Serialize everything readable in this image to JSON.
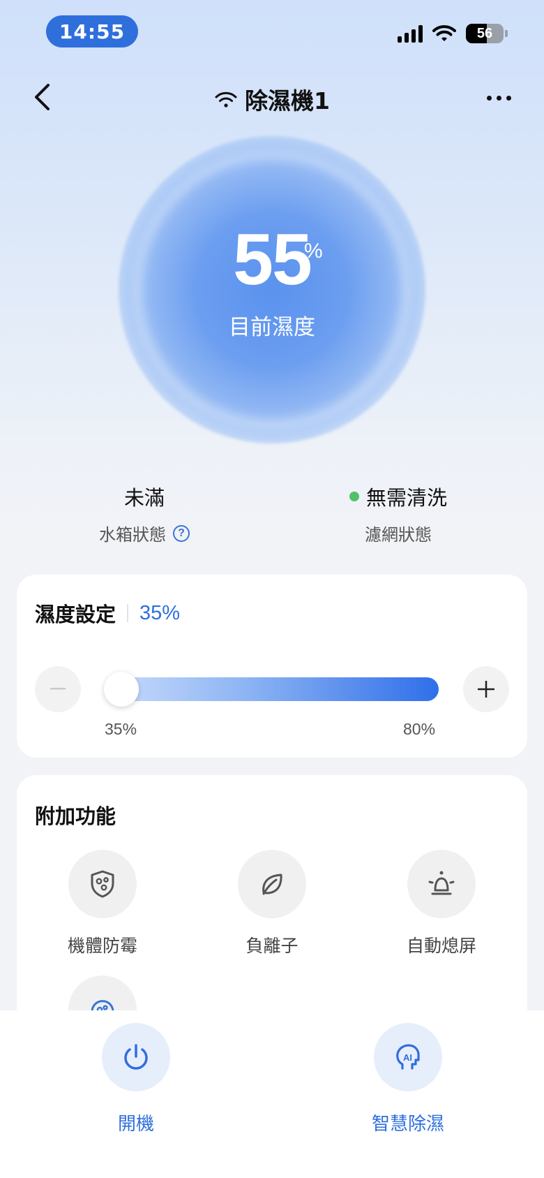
{
  "status_bar": {
    "time": "14:55",
    "battery": "56"
  },
  "header": {
    "title": "除濕機1"
  },
  "humidity": {
    "value": "55",
    "unit": "%",
    "label": "目前濕度"
  },
  "status": {
    "water_tank": {
      "value": "未滿",
      "label": "水箱狀態"
    },
    "filter": {
      "value": "無需清洗",
      "label": "濾網狀態",
      "indicator_color": "#4fc269"
    }
  },
  "setting": {
    "title": "濕度設定",
    "value": "35%",
    "level": 35,
    "min_label": "35%",
    "max_label": "80%",
    "accent": "#2f6fdc"
  },
  "extra": {
    "title": "附加功能",
    "features": [
      {
        "icon": "shield-mold-icon",
        "label": "機體防霉"
      },
      {
        "icon": "leaf-icon",
        "label": "負離子"
      },
      {
        "icon": "bulb-off-icon",
        "label": "自動熄屏"
      },
      {
        "icon": "gauge-icon",
        "label": ""
      }
    ]
  },
  "bottom": {
    "power_label": "開機",
    "ai_label": "智慧除濕"
  }
}
